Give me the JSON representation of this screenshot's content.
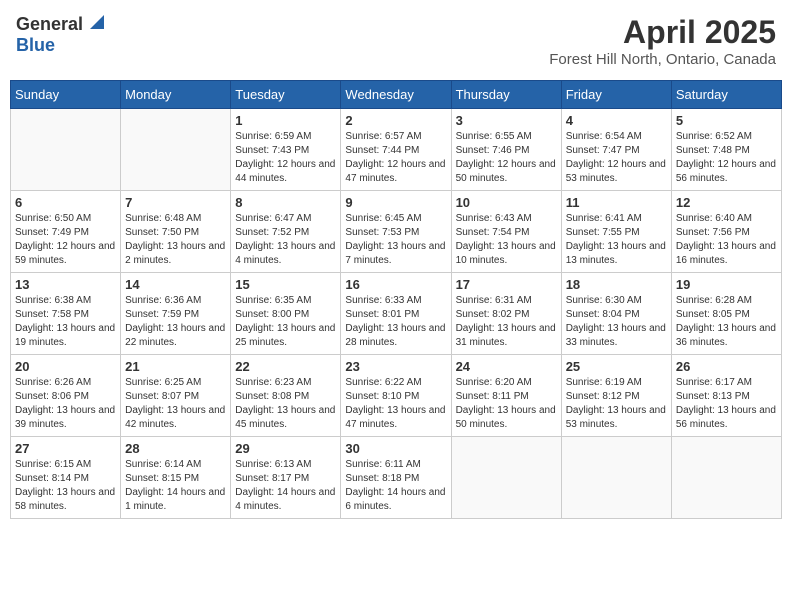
{
  "logo": {
    "general": "General",
    "blue": "Blue"
  },
  "title": "April 2025",
  "subtitle": "Forest Hill North, Ontario, Canada",
  "days_header": [
    "Sunday",
    "Monday",
    "Tuesday",
    "Wednesday",
    "Thursday",
    "Friday",
    "Saturday"
  ],
  "weeks": [
    [
      {
        "num": "",
        "sunrise": "",
        "sunset": "",
        "daylight": ""
      },
      {
        "num": "",
        "sunrise": "",
        "sunset": "",
        "daylight": ""
      },
      {
        "num": "1",
        "sunrise": "Sunrise: 6:59 AM",
        "sunset": "Sunset: 7:43 PM",
        "daylight": "Daylight: 12 hours and 44 minutes."
      },
      {
        "num": "2",
        "sunrise": "Sunrise: 6:57 AM",
        "sunset": "Sunset: 7:44 PM",
        "daylight": "Daylight: 12 hours and 47 minutes."
      },
      {
        "num": "3",
        "sunrise": "Sunrise: 6:55 AM",
        "sunset": "Sunset: 7:46 PM",
        "daylight": "Daylight: 12 hours and 50 minutes."
      },
      {
        "num": "4",
        "sunrise": "Sunrise: 6:54 AM",
        "sunset": "Sunset: 7:47 PM",
        "daylight": "Daylight: 12 hours and 53 minutes."
      },
      {
        "num": "5",
        "sunrise": "Sunrise: 6:52 AM",
        "sunset": "Sunset: 7:48 PM",
        "daylight": "Daylight: 12 hours and 56 minutes."
      }
    ],
    [
      {
        "num": "6",
        "sunrise": "Sunrise: 6:50 AM",
        "sunset": "Sunset: 7:49 PM",
        "daylight": "Daylight: 12 hours and 59 minutes."
      },
      {
        "num": "7",
        "sunrise": "Sunrise: 6:48 AM",
        "sunset": "Sunset: 7:50 PM",
        "daylight": "Daylight: 13 hours and 2 minutes."
      },
      {
        "num": "8",
        "sunrise": "Sunrise: 6:47 AM",
        "sunset": "Sunset: 7:52 PM",
        "daylight": "Daylight: 13 hours and 4 minutes."
      },
      {
        "num": "9",
        "sunrise": "Sunrise: 6:45 AM",
        "sunset": "Sunset: 7:53 PM",
        "daylight": "Daylight: 13 hours and 7 minutes."
      },
      {
        "num": "10",
        "sunrise": "Sunrise: 6:43 AM",
        "sunset": "Sunset: 7:54 PM",
        "daylight": "Daylight: 13 hours and 10 minutes."
      },
      {
        "num": "11",
        "sunrise": "Sunrise: 6:41 AM",
        "sunset": "Sunset: 7:55 PM",
        "daylight": "Daylight: 13 hours and 13 minutes."
      },
      {
        "num": "12",
        "sunrise": "Sunrise: 6:40 AM",
        "sunset": "Sunset: 7:56 PM",
        "daylight": "Daylight: 13 hours and 16 minutes."
      }
    ],
    [
      {
        "num": "13",
        "sunrise": "Sunrise: 6:38 AM",
        "sunset": "Sunset: 7:58 PM",
        "daylight": "Daylight: 13 hours and 19 minutes."
      },
      {
        "num": "14",
        "sunrise": "Sunrise: 6:36 AM",
        "sunset": "Sunset: 7:59 PM",
        "daylight": "Daylight: 13 hours and 22 minutes."
      },
      {
        "num": "15",
        "sunrise": "Sunrise: 6:35 AM",
        "sunset": "Sunset: 8:00 PM",
        "daylight": "Daylight: 13 hours and 25 minutes."
      },
      {
        "num": "16",
        "sunrise": "Sunrise: 6:33 AM",
        "sunset": "Sunset: 8:01 PM",
        "daylight": "Daylight: 13 hours and 28 minutes."
      },
      {
        "num": "17",
        "sunrise": "Sunrise: 6:31 AM",
        "sunset": "Sunset: 8:02 PM",
        "daylight": "Daylight: 13 hours and 31 minutes."
      },
      {
        "num": "18",
        "sunrise": "Sunrise: 6:30 AM",
        "sunset": "Sunset: 8:04 PM",
        "daylight": "Daylight: 13 hours and 33 minutes."
      },
      {
        "num": "19",
        "sunrise": "Sunrise: 6:28 AM",
        "sunset": "Sunset: 8:05 PM",
        "daylight": "Daylight: 13 hours and 36 minutes."
      }
    ],
    [
      {
        "num": "20",
        "sunrise": "Sunrise: 6:26 AM",
        "sunset": "Sunset: 8:06 PM",
        "daylight": "Daylight: 13 hours and 39 minutes."
      },
      {
        "num": "21",
        "sunrise": "Sunrise: 6:25 AM",
        "sunset": "Sunset: 8:07 PM",
        "daylight": "Daylight: 13 hours and 42 minutes."
      },
      {
        "num": "22",
        "sunrise": "Sunrise: 6:23 AM",
        "sunset": "Sunset: 8:08 PM",
        "daylight": "Daylight: 13 hours and 45 minutes."
      },
      {
        "num": "23",
        "sunrise": "Sunrise: 6:22 AM",
        "sunset": "Sunset: 8:10 PM",
        "daylight": "Daylight: 13 hours and 47 minutes."
      },
      {
        "num": "24",
        "sunrise": "Sunrise: 6:20 AM",
        "sunset": "Sunset: 8:11 PM",
        "daylight": "Daylight: 13 hours and 50 minutes."
      },
      {
        "num": "25",
        "sunrise": "Sunrise: 6:19 AM",
        "sunset": "Sunset: 8:12 PM",
        "daylight": "Daylight: 13 hours and 53 minutes."
      },
      {
        "num": "26",
        "sunrise": "Sunrise: 6:17 AM",
        "sunset": "Sunset: 8:13 PM",
        "daylight": "Daylight: 13 hours and 56 minutes."
      }
    ],
    [
      {
        "num": "27",
        "sunrise": "Sunrise: 6:15 AM",
        "sunset": "Sunset: 8:14 PM",
        "daylight": "Daylight: 13 hours and 58 minutes."
      },
      {
        "num": "28",
        "sunrise": "Sunrise: 6:14 AM",
        "sunset": "Sunset: 8:15 PM",
        "daylight": "Daylight: 14 hours and 1 minute."
      },
      {
        "num": "29",
        "sunrise": "Sunrise: 6:13 AM",
        "sunset": "Sunset: 8:17 PM",
        "daylight": "Daylight: 14 hours and 4 minutes."
      },
      {
        "num": "30",
        "sunrise": "Sunrise: 6:11 AM",
        "sunset": "Sunset: 8:18 PM",
        "daylight": "Daylight: 14 hours and 6 minutes."
      },
      {
        "num": "",
        "sunrise": "",
        "sunset": "",
        "daylight": ""
      },
      {
        "num": "",
        "sunrise": "",
        "sunset": "",
        "daylight": ""
      },
      {
        "num": "",
        "sunrise": "",
        "sunset": "",
        "daylight": ""
      }
    ]
  ]
}
